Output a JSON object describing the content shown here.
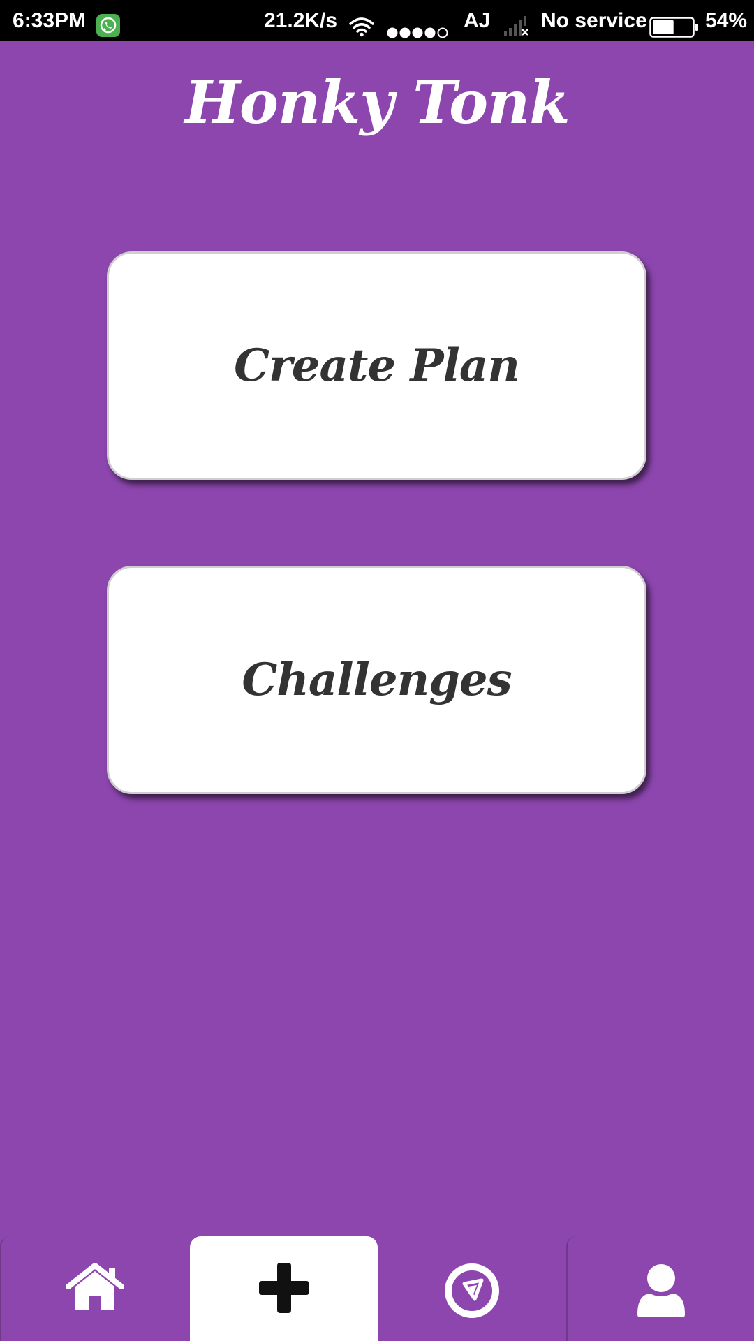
{
  "status_bar": {
    "time": "6:33PM",
    "notification_icon": "whatsapp-icon",
    "network_speed": "21.2K/s",
    "wifi_icon": "wifi-icon",
    "carrier": "AJ",
    "signal_icon": "no-signal-icon",
    "service_text": "No service",
    "battery_icon": "battery-icon",
    "battery_level": 0.54,
    "battery_percent": "54%"
  },
  "header": {
    "title": "Honky Tonk"
  },
  "menu": {
    "create_plan_label": "Create Plan",
    "challenges_label": "Challenges"
  },
  "bottom_nav": {
    "tabs": [
      {
        "icon": "home-icon",
        "active": false
      },
      {
        "icon": "plus-icon",
        "active": true
      },
      {
        "icon": "play-circle-icon",
        "active": false
      },
      {
        "icon": "user-icon",
        "active": false
      }
    ]
  },
  "colors": {
    "background": "#8c46ae",
    "card": "#ffffff",
    "card_text": "#333333",
    "title_text": "#ffffff",
    "status_bar": "#000000",
    "whatsapp_green": "#4caf50"
  }
}
